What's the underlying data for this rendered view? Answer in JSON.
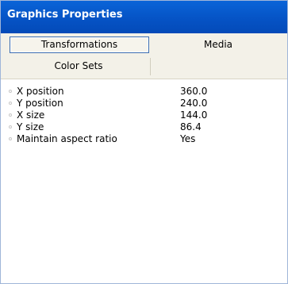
{
  "panel": {
    "title": "Graphics Properties"
  },
  "tabs": [
    {
      "label": "Transformations",
      "selected": true
    },
    {
      "label": "Media",
      "selected": false
    },
    {
      "label": "Color Sets",
      "selected": false
    }
  ],
  "properties": [
    {
      "name": "X position",
      "value": "360.0"
    },
    {
      "name": "Y position",
      "value": "240.0"
    },
    {
      "name": "X size",
      "value": "144.0"
    },
    {
      "name": "Y size",
      "value": "86.4"
    },
    {
      "name": "Maintain aspect ratio",
      "value": "Yes"
    }
  ],
  "colors": {
    "title_bar": "#0552c4",
    "tab_strip": "#f3f1e8",
    "selected_tab_border": "#3c6db0"
  }
}
